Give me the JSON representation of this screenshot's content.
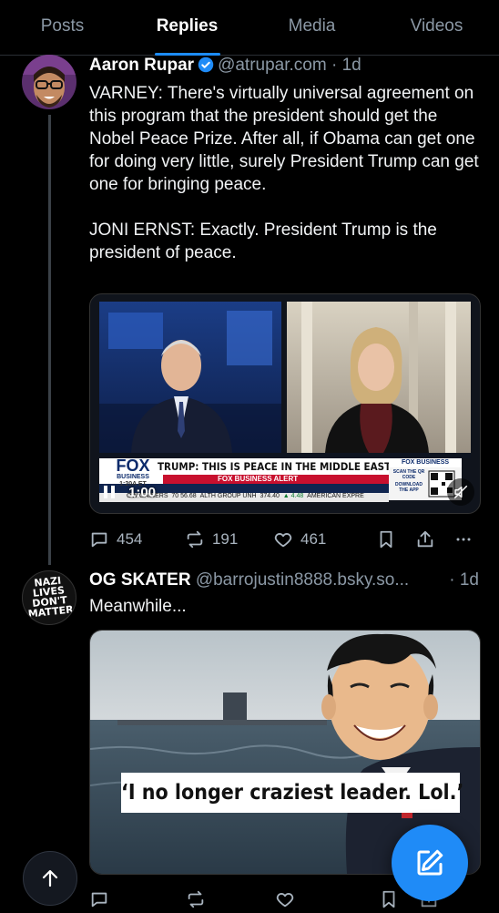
{
  "tabs": [
    {
      "label": "Posts"
    },
    {
      "label": "Replies"
    },
    {
      "label": "Media"
    },
    {
      "label": "Videos"
    }
  ],
  "posts": [
    {
      "name": "Aaron Rupar",
      "handle": "@atrupar.com",
      "dot": "·",
      "time": "1d",
      "text": "VARNEY: There's virtually universal agreement on this program that the president should get the Nobel Peace Prize. After all, if Obama can get one for doing very little, surely President Trump can get one for bringing peace.\n\nJONI ERNST: Exactly. President Trump is the president of peace.",
      "video": {
        "network_logo": "FOX",
        "network_sub": "BUSINESS",
        "headline": "TRUMP: THIS IS PEACE IN THE MIDDLE EAST",
        "alert": "FOX BUSINESS ALERT",
        "corner_logo": "FOX BUSINESS",
        "qr_label": "SCAN THE QR CODE",
        "qr_sub": "DOWNLOAD THE APP",
        "clock": "1:20A ET",
        "ticker_1": "OW GAINERS",
        "ticker_2": "ALTH GROUP UNH",
        "ticker_3": "374.40",
        "ticker_4": "▲ 4.48",
        "ticker_5": "AMERICAN EXPRE",
        "ticker_num1": "70",
        "ticker_num2": "56.68",
        "duration": "1:00"
      },
      "stats": {
        "replies": "454",
        "reposts": "191",
        "likes": "461"
      }
    },
    {
      "name": "OG SKATER",
      "handle": "@barrojustin8888.bsky.so...",
      "dot": "·",
      "time": "1d",
      "avatar_text": [
        "NAZI",
        "LIVES",
        "DON'T",
        "MATTER"
      ],
      "text": "Meanwhile...",
      "image_caption": "‘I no longer craziest leader. Lol.’"
    }
  ],
  "colors": {
    "accent": "#1f8bf7",
    "muted": "#8b98a5"
  }
}
